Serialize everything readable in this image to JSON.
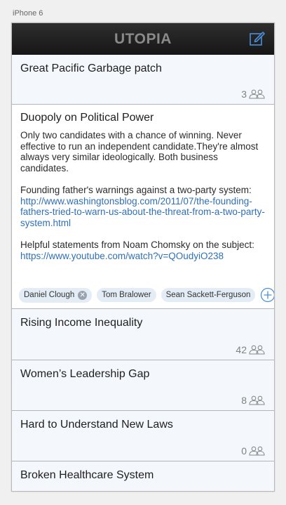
{
  "device_label": "iPhone 6",
  "app": {
    "title": "UTOPIA"
  },
  "issues": [
    {
      "title": "Great Pacific Garbage patch",
      "count": "3"
    },
    {
      "title": "Duopoly on Political Power",
      "paragraphs": [
        {
          "text": "Only two candidates with a chance of winning. Never effective to run an independent candidate.They're almost always very similar ideologically. Both business candidates."
        },
        {
          "text": "Founding father's warnings against a two-party system: ",
          "link": "http://www.washingtonsblog.com/2011/07/the-founding-fathers-tried-to-warn-us-about-the-threat-from-a-two-party-system.html"
        },
        {
          "text": "Helpful statements from Noam Chomsky on the subject: ",
          "link": "https://www.youtube.com/watch?v=QOudyiO238"
        }
      ],
      "tags": [
        "Daniel Clough",
        "Tom Bralower",
        "Sean Sackett-Ferguson"
      ]
    },
    {
      "title": "Rising Income Inequality",
      "count": "42"
    },
    {
      "title": "Women’s Leadership Gap",
      "count": "8"
    },
    {
      "title": "Hard to Understand New Laws",
      "count": "0"
    },
    {
      "title": "Broken Healthcare System"
    }
  ],
  "icons": {
    "compose": "compose-icon",
    "people": "people-icon",
    "add": "add-circle-icon",
    "remove": "remove-tag-icon"
  },
  "colors": {
    "accent": "#2f6fb9",
    "navbar": "#1c1c1c",
    "tag": "#e4ecf5"
  }
}
